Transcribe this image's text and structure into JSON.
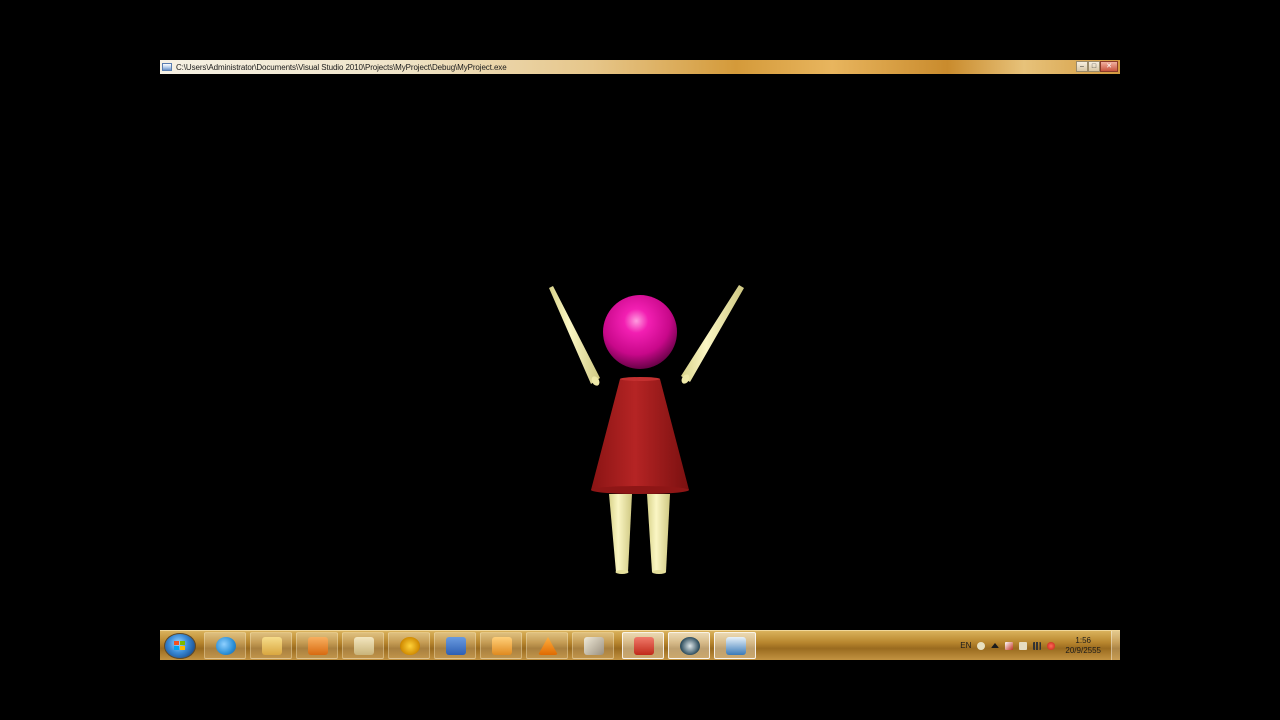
{
  "window": {
    "title": "C:\\Users\\Administrator\\Documents\\Visual Studio 2010\\Projects\\MyProject\\Debug\\MyProject.exe",
    "controls": {
      "minimize": "–",
      "maximize": "□",
      "close": "✕"
    }
  },
  "scene": {
    "background_color": "#000000",
    "figure": {
      "head_color": "#e0109a",
      "dress_color": "#a82020",
      "limb_color": "#f2ecaa"
    }
  },
  "taskbar": {
    "start_icon": "windows-start-orb",
    "items": [
      {
        "name": "internet-explorer",
        "icon": "ie-icon",
        "color": "#2a8fd8"
      },
      {
        "name": "windows-explorer",
        "icon": "folder-icon",
        "color": "#e9c063"
      },
      {
        "name": "media-player",
        "icon": "media-player-icon",
        "color": "#e07a20"
      },
      {
        "name": "paint",
        "icon": "paint-icon",
        "color": "#d9c48a"
      },
      {
        "name": "app-yellow",
        "icon": "triangle-app-icon",
        "color": "#f2b400"
      },
      {
        "name": "microsoft-word",
        "icon": "word-icon",
        "color": "#2d5fb3"
      },
      {
        "name": "archive",
        "icon": "archive-icon",
        "color": "#f0a030"
      },
      {
        "name": "vlc",
        "icon": "vlc-icon",
        "color": "#f08a00"
      },
      {
        "name": "tool-app",
        "icon": "tools-icon",
        "color": "#d8d0c0"
      },
      {
        "name": "recorder",
        "icon": "record-icon",
        "color": "#d83a2a"
      },
      {
        "name": "capture-app",
        "icon": "capture-icon",
        "color": "#2a4a5a"
      },
      {
        "name": "myproject-window",
        "icon": "window-icon",
        "color": "#3a7ab8"
      }
    ],
    "tray": {
      "language": "EN",
      "time": "1:56",
      "date": "20/9/2555"
    }
  }
}
